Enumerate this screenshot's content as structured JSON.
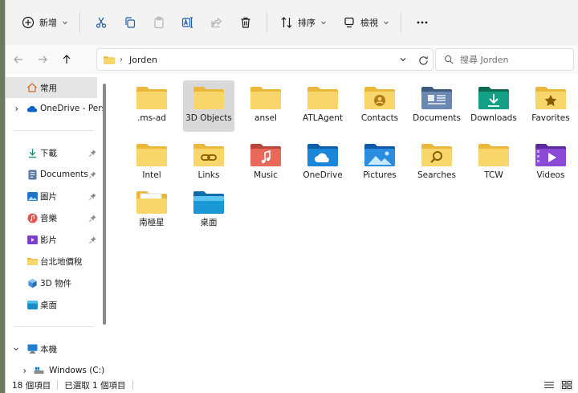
{
  "toolbar": {
    "new_label": "新增",
    "sort_label": "排序",
    "view_label": "檢視"
  },
  "address": {
    "path": "Jorden"
  },
  "search": {
    "placeholder": "搜尋 Jorden"
  },
  "sidebar": {
    "items": [
      {
        "label": "常用",
        "icon": "home-icon"
      },
      {
        "label": "OneDrive - Pers",
        "icon": "cloud-icon"
      },
      {
        "label": "下載",
        "icon": "download-icon"
      },
      {
        "label": "Documents",
        "icon": "document-icon"
      },
      {
        "label": "圖片",
        "icon": "picture-icon"
      },
      {
        "label": "音樂",
        "icon": "music-icon"
      },
      {
        "label": "影片",
        "icon": "video-icon"
      },
      {
        "label": "台北地價稅",
        "icon": "folder-icon"
      },
      {
        "label": "3D 物件",
        "icon": "cube-icon"
      },
      {
        "label": "桌面",
        "icon": "desktop-icon"
      },
      {
        "label": "本機",
        "icon": "computer-icon"
      },
      {
        "label": "Windows (C:)",
        "icon": "drive-icon"
      }
    ]
  },
  "files": [
    {
      "label": ".ms-ad",
      "icon": "folder-icon"
    },
    {
      "label": "3D Objects",
      "icon": "folder-icon"
    },
    {
      "label": "ansel",
      "icon": "folder-icon"
    },
    {
      "label": "ATLAgent",
      "icon": "folder-icon"
    },
    {
      "label": "Contacts",
      "icon": "contacts-folder-icon"
    },
    {
      "label": "Documents",
      "icon": "documents-folder-icon"
    },
    {
      "label": "Downloads",
      "icon": "downloads-folder-icon"
    },
    {
      "label": "Favorites",
      "icon": "favorites-folder-icon"
    },
    {
      "label": "Intel",
      "icon": "folder-icon"
    },
    {
      "label": "Links",
      "icon": "links-folder-icon"
    },
    {
      "label": "Music",
      "icon": "music-folder-icon"
    },
    {
      "label": "OneDrive",
      "icon": "onedrive-folder-icon"
    },
    {
      "label": "Pictures",
      "icon": "pictures-folder-icon"
    },
    {
      "label": "Searches",
      "icon": "searches-folder-icon"
    },
    {
      "label": "TCW",
      "icon": "folder-icon"
    },
    {
      "label": "Videos",
      "icon": "videos-folder-icon"
    },
    {
      "label": "南極星",
      "icon": "folder-with-files-icon"
    },
    {
      "label": "桌面",
      "icon": "desktop-folder-icon"
    }
  ],
  "status": {
    "count": "18 個項目",
    "selected": "已選取 1 個項目"
  },
  "colors": {
    "folder": "#f8d66a",
    "folder_back": "#eab83a",
    "accent": "#0067c0",
    "selection": "#d9d9d9"
  }
}
